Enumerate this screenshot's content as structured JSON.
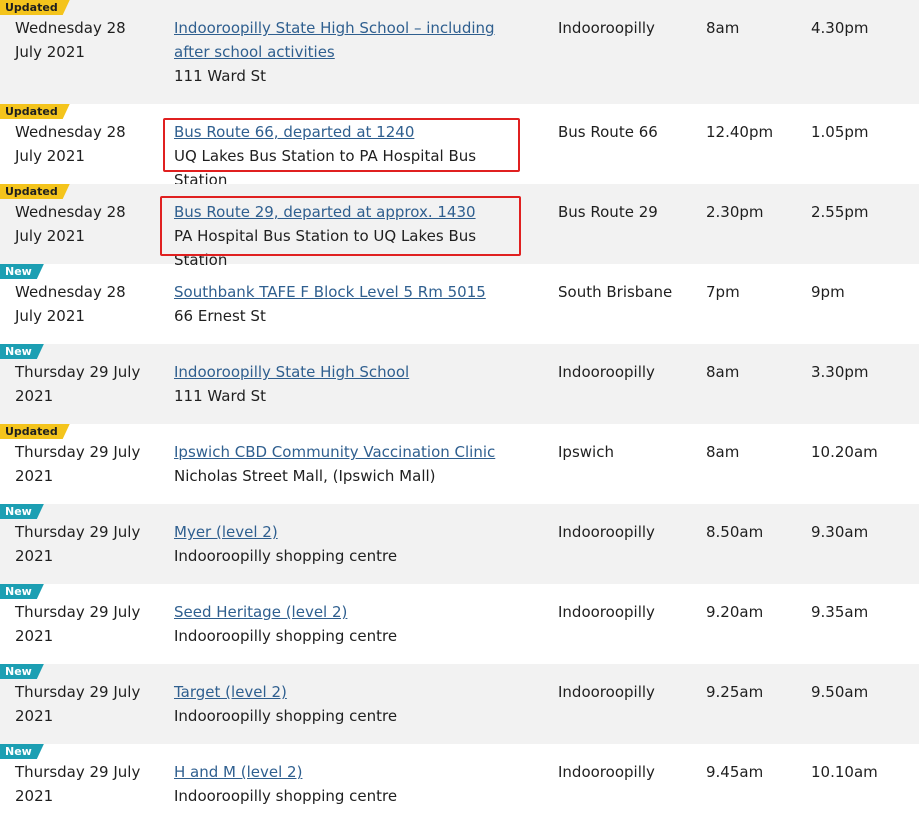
{
  "rows": [
    {
      "badge": "Updated",
      "date": "Wednesday 28 July 2021",
      "place": "Indooroopilly State High School – including after school activities",
      "address": "111 Ward St",
      "suburb": "Indooroopilly",
      "start": "8am",
      "end": "4.30pm"
    },
    {
      "badge": "Updated",
      "date": "Wednesday 28 July 2021",
      "place": "Bus Route 66, departed at 1240",
      "address": "UQ Lakes Bus Station to PA Hospital Bus Station",
      "suburb": "Bus Route 66",
      "start": "12.40pm",
      "end": "1.05pm",
      "highlighted": true
    },
    {
      "badge": "Updated",
      "date": "Wednesday 28 July 2021",
      "place": "Bus Route 29, departed at approx. 1430",
      "address": "PA Hospital Bus Station to UQ Lakes Bus Station",
      "suburb": "Bus Route 29",
      "start": "2.30pm",
      "end": "2.55pm",
      "highlighted": true
    },
    {
      "badge": "New",
      "date": "Wednesday 28 July 2021",
      "place": "Southbank TAFE F Block Level 5 Rm 5015",
      "address": "66 Ernest St",
      "suburb": "South Brisbane",
      "start": "7pm",
      "end": "9pm"
    },
    {
      "badge": "New",
      "date": "Thursday 29 July 2021",
      "place": "Indooroopilly State High School",
      "address": "111 Ward St",
      "suburb": "Indooroopilly",
      "start": "8am",
      "end": "3.30pm"
    },
    {
      "badge": "Updated",
      "date": "Thursday 29 July 2021",
      "place": "Ipswich CBD Community Vaccination Clinic",
      "address": "Nicholas Street Mall, (Ipswich Mall)",
      "suburb": "Ipswich",
      "start": "8am",
      "end": "10.20am"
    },
    {
      "badge": "New",
      "date": "Thursday 29 July 2021",
      "place": "Myer (level 2)",
      "address": "Indooroopilly shopping centre",
      "suburb": "Indooroopilly",
      "start": "8.50am",
      "end": "9.30am"
    },
    {
      "badge": "New",
      "date": "Thursday 29 July 2021",
      "place": "Seed Heritage (level 2)",
      "address": "Indooroopilly shopping centre",
      "suburb": "Indooroopilly",
      "start": "9.20am",
      "end": "9.35am"
    },
    {
      "badge": "New",
      "date": "Thursday 29 July 2021",
      "place": "Target  (level 2)",
      "address": "Indooroopilly shopping centre",
      "suburb": "Indooroopilly",
      "start": "9.25am",
      "end": "9.50am"
    },
    {
      "badge": "New",
      "date": "Thursday 29 July 2021",
      "place": "H and M (level 2)",
      "address": "Indooroopilly shopping centre",
      "suburb": "Indooroopilly",
      "start": "9.45am",
      "end": "10.10am"
    }
  ],
  "colors": {
    "updated_badge": "#f4c41c",
    "new_badge": "#1c9fb3",
    "link": "#2f5f8f",
    "highlight_border": "#e02020",
    "row_alt": "#f2f2f2"
  }
}
